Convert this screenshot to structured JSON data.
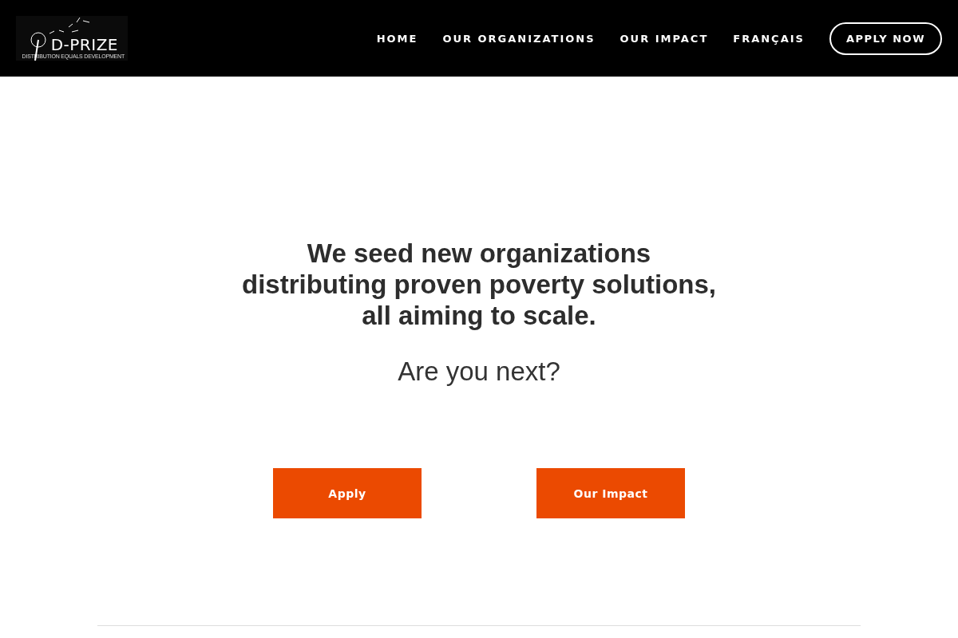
{
  "logo": {
    "name": "D-PRIZE",
    "tagline": "DISTRIBUTION EQUALS DEVELOPMENT"
  },
  "nav": [
    {
      "label": "HOME"
    },
    {
      "label": "OUR ORGANIZATIONS"
    },
    {
      "label": "OUR IMPACT"
    },
    {
      "label": "FRANÇAIS"
    }
  ],
  "cta": "APPLY NOW",
  "hero": {
    "headline": [
      "We seed new organizations",
      "distributing proven poverty solutions,",
      "all aiming to scale."
    ],
    "subheadline": "Are you next?"
  },
  "buttons": [
    "Apply",
    "Our Impact"
  ]
}
